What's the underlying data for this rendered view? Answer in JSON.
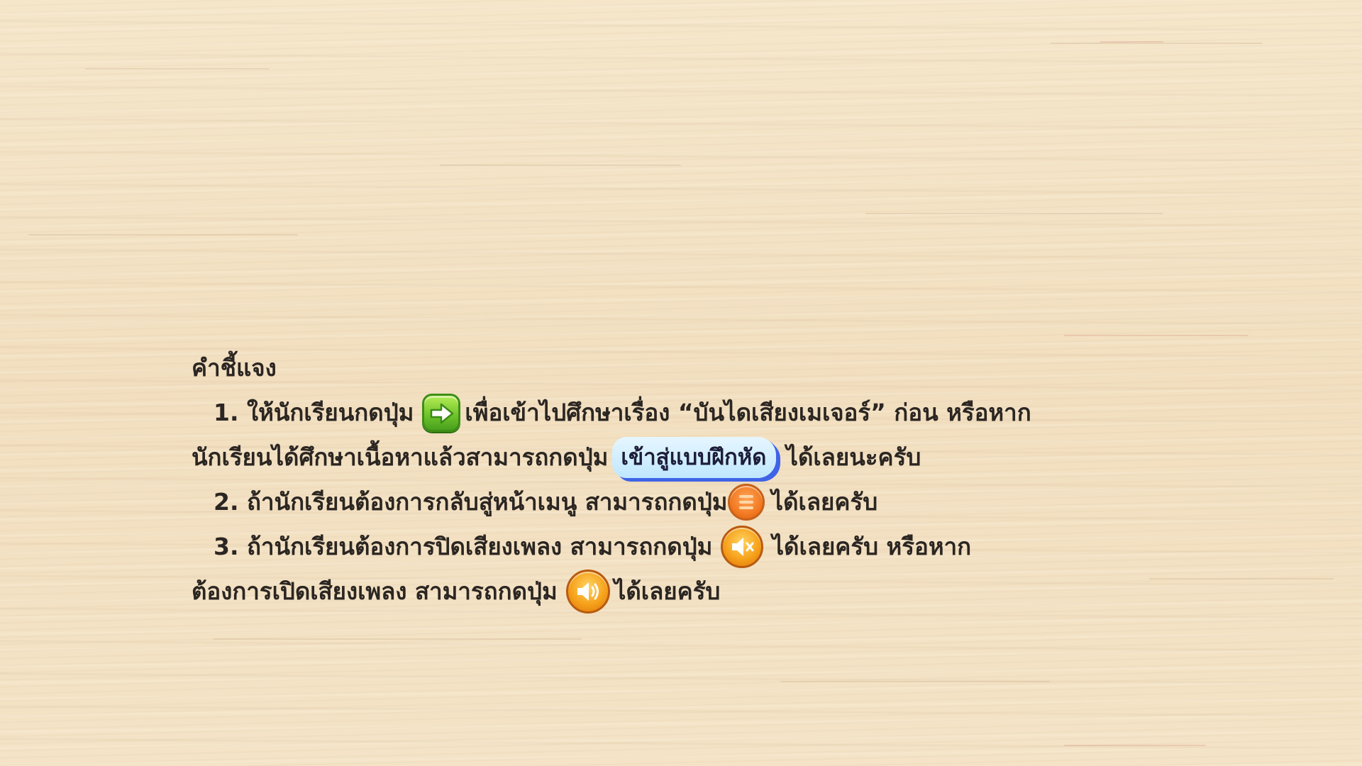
{
  "heading": "คำชี้แจง",
  "item1": {
    "number": "1.",
    "before_icon": "ให้นักเรียนกดปุ่ม",
    "icon": "arrow-right-icon",
    "after_icon": "เพื่อเข้าไปศึกษาเรื่อง “บันไดเสียงเมเจอร์” ก่อน หรือหาก",
    "line2_before_button": "นักเรียนได้ศึกษาเนื้อหาแล้วสามารถกดปุ่ม",
    "practice_button_label": "เข้าสู่แบบฝึกหัด",
    "line2_after_button": "ได้เลยนะครับ"
  },
  "item2": {
    "number": "2.",
    "before_icon": "ถ้านักเรียนต้องการกลับสู่หน้าเมนู สามารถกดปุ่ม",
    "icon": "menu-icon",
    "after_icon": "ได้เลยครับ"
  },
  "item3": {
    "number": "3.",
    "before_icon": "ถ้านักเรียนต้องการปิดเสียงเพลง สามารถกดปุ่ม",
    "icon": "speaker-mute-icon",
    "after_icon": "ได้เลยครับ หรือหาก",
    "line2_before_icon": "ต้องการเปิดเสียงเพลง สามารถกดปุ่ม",
    "line2_icon": "speaker-on-icon",
    "line2_after_icon": "ได้เลยครับ"
  },
  "colors": {
    "background": "#f3e1c3",
    "text": "#2b2622",
    "next_button": "#6cc12a",
    "practice_button": "#bfe7ff",
    "practice_button_shadow": "#3f64e6",
    "menu_button": "#f27a22",
    "sound_button": "#f6a21c"
  }
}
